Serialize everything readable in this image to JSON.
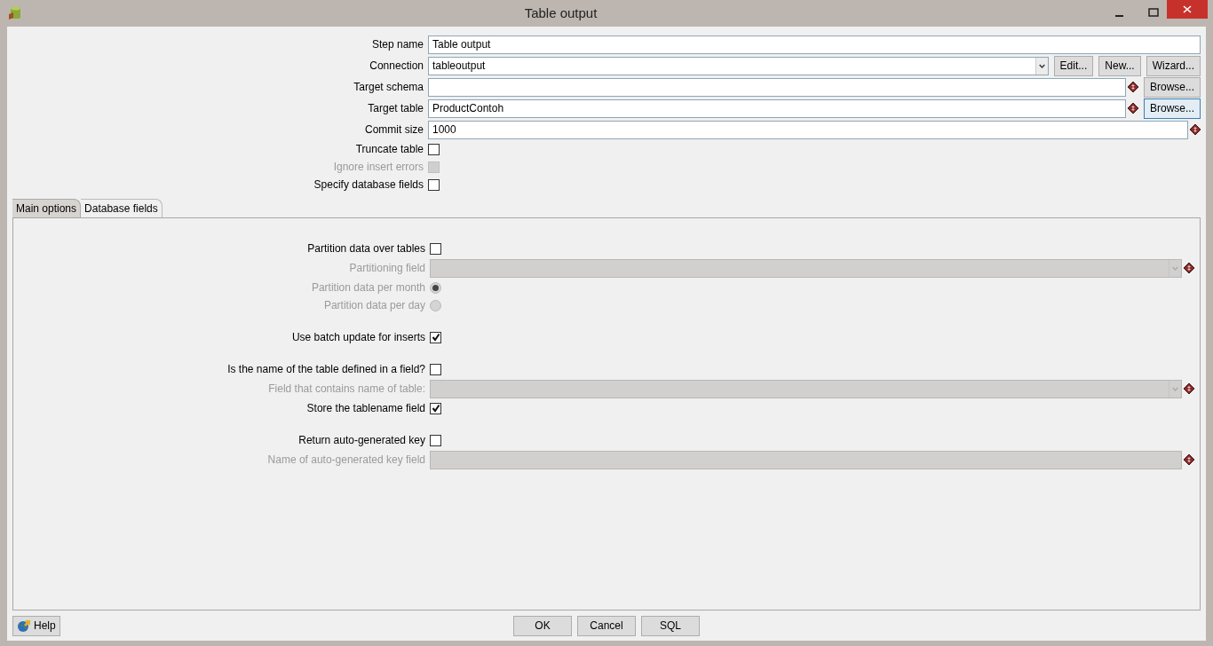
{
  "window": {
    "title": "Table output"
  },
  "fields": [
    {
      "kind": "text",
      "label": "Step name",
      "value": "Table output",
      "variable": false,
      "disabled": false
    },
    {
      "kind": "combo",
      "label": "Connection",
      "value": "tableoutput",
      "variable": false,
      "disabled": false,
      "buttons": [
        {
          "label": "Edit...",
          "focused": false
        },
        {
          "label": "New...",
          "focused": false
        },
        {
          "label": "Wizard...",
          "focused": false
        }
      ]
    },
    {
      "kind": "text",
      "label": "Target schema",
      "variable": true,
      "disabled": false,
      "buttons": [
        {
          "label": "Browse...",
          "focused": false
        }
      ]
    },
    {
      "kind": "text",
      "label": "Target table",
      "value": "ProductContoh",
      "variable": true,
      "disabled": false,
      "buttons": [
        {
          "label": "Browse...",
          "focused": true
        }
      ]
    },
    {
      "kind": "text",
      "label": "Commit size",
      "value": "1000",
      "variable": true,
      "disabled": false
    },
    {
      "kind": "checkbox",
      "label": "Truncate table",
      "checked": false,
      "disabled": false
    },
    {
      "kind": "checkbox",
      "label": "Ignore insert errors",
      "checked": false,
      "disabled": true
    },
    {
      "kind": "checkbox",
      "label": "Specify database fields",
      "checked": false,
      "disabled": false
    }
  ],
  "tabs": [
    {
      "label": "Main options",
      "selected": true
    },
    {
      "label": "Database fields",
      "selected": false
    }
  ],
  "main_options": [
    [
      {
        "kind": "checkbox",
        "label": "Partition data over tables",
        "checked": false,
        "disabled": false
      },
      {
        "kind": "combo",
        "label": "Partitioning field",
        "variable": true,
        "disabled": true
      },
      {
        "kind": "radio",
        "label": "Partition data per month",
        "selected": true,
        "disabled": true
      },
      {
        "kind": "radio",
        "label": "Partition data per day",
        "selected": false,
        "disabled": true
      }
    ],
    [
      {
        "kind": "checkbox",
        "label": "Use batch update for inserts",
        "checked": true,
        "disabled": false
      }
    ],
    [
      {
        "kind": "checkbox",
        "label": "Is the name of the table defined in a field?",
        "checked": false,
        "disabled": false
      },
      {
        "kind": "combo",
        "label": "Field that contains name of table:",
        "variable": true,
        "disabled": true
      },
      {
        "kind": "checkbox",
        "label": "Store the tablename field",
        "checked": true,
        "disabled": false
      }
    ],
    [
      {
        "kind": "checkbox",
        "label": "Return auto-generated key",
        "checked": false,
        "disabled": false
      },
      {
        "kind": "text",
        "label": "Name of auto-generated key field",
        "variable": true,
        "disabled": true
      }
    ]
  ],
  "help_button": "Help",
  "buttons": [
    "OK",
    "Cancel",
    "SQL"
  ]
}
